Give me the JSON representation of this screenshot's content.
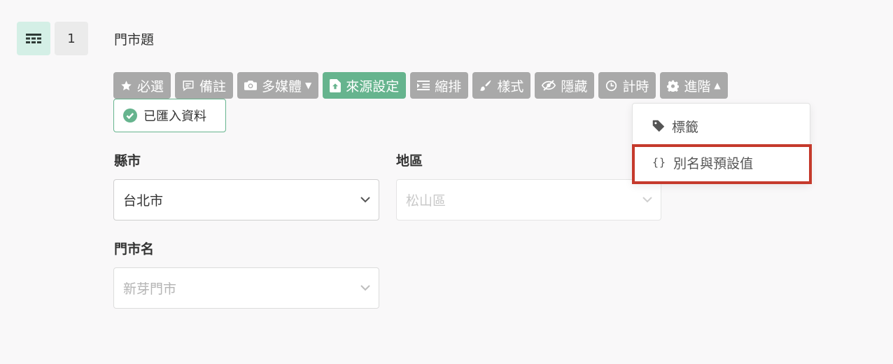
{
  "question": {
    "number": "1",
    "title": "門市題",
    "type_icon": "table-icon"
  },
  "toolbar": {
    "required_label": "必選",
    "note_label": "備註",
    "media_label": "多媒體",
    "source_label": "來源設定",
    "indent_label": "縮排",
    "style_label": "樣式",
    "hide_label": "隱藏",
    "timer_label": "計時",
    "advanced_label": "進階"
  },
  "imported_badge": {
    "label": "已匯入資料"
  },
  "fields": {
    "city": {
      "label": "縣市",
      "value": "台北市"
    },
    "district": {
      "label": "地區",
      "value": "松山區"
    },
    "store": {
      "label": "門市名",
      "value": "新芽門市"
    }
  },
  "advanced_menu": {
    "items": [
      {
        "label": "標籤",
        "icon": "tag-icon"
      },
      {
        "label": "別名與預設值",
        "icon": "braces-icon"
      }
    ]
  },
  "colors": {
    "accent_green": "#66b48e",
    "toolbar_gray": "#a9a9a9",
    "highlight_red": "#c53a2c",
    "icon_bg": "#d4efe6"
  }
}
